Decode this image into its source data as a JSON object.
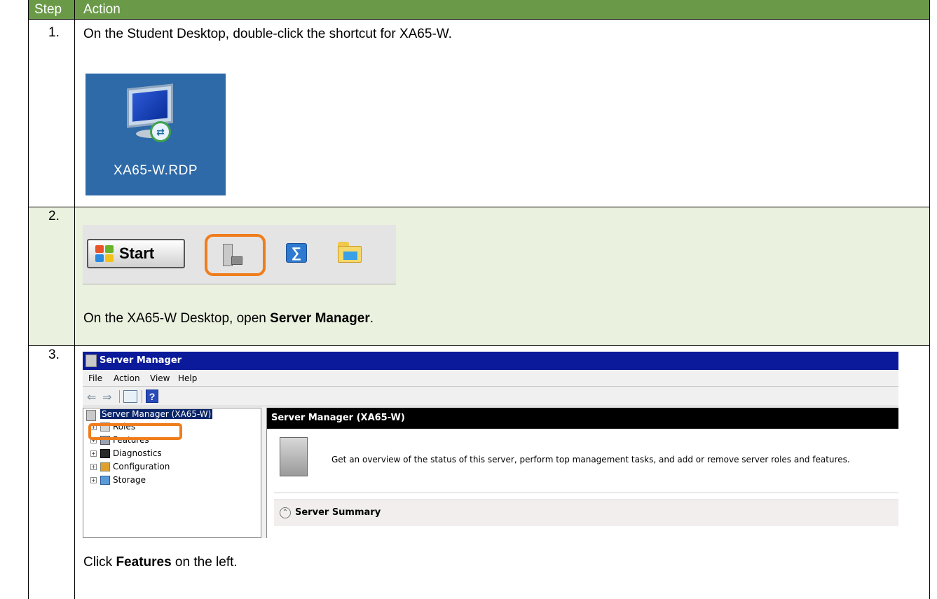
{
  "header": {
    "step": "Step",
    "action": "Action"
  },
  "rows": [
    {
      "num": "1.",
      "text": "On the Student Desktop, double-click the shortcut for XA65-W.",
      "icon_label": "XA65-W.RDP"
    },
    {
      "num": "2.",
      "start_label": "Start",
      "text_before": "On the XA65-W Desktop, open ",
      "text_bold": "Server Manager",
      "text_after": "."
    },
    {
      "num": "3.",
      "text_before": "Click ",
      "text_bold": "Features",
      "text_after": " on the left."
    }
  ],
  "server_manager": {
    "title": "Server Manager",
    "menu": [
      "File",
      "Action",
      "View",
      "Help"
    ],
    "tree": {
      "root": "Server Manager (XA65-W)",
      "items": [
        "Roles",
        "Features",
        "Diagnostics",
        "Configuration",
        "Storage"
      ]
    },
    "panel_title": "Server Manager (XA65-W)",
    "description": "Get an overview of the status of this server, perform top management tasks, and add or remove server roles and features.",
    "summary": "Server Summary"
  },
  "colors": {
    "header_bg": "#6a9a48",
    "row2_bg": "#eaf1df",
    "highlight": "#f07d1c",
    "titlebar": "#0a1a9a"
  }
}
